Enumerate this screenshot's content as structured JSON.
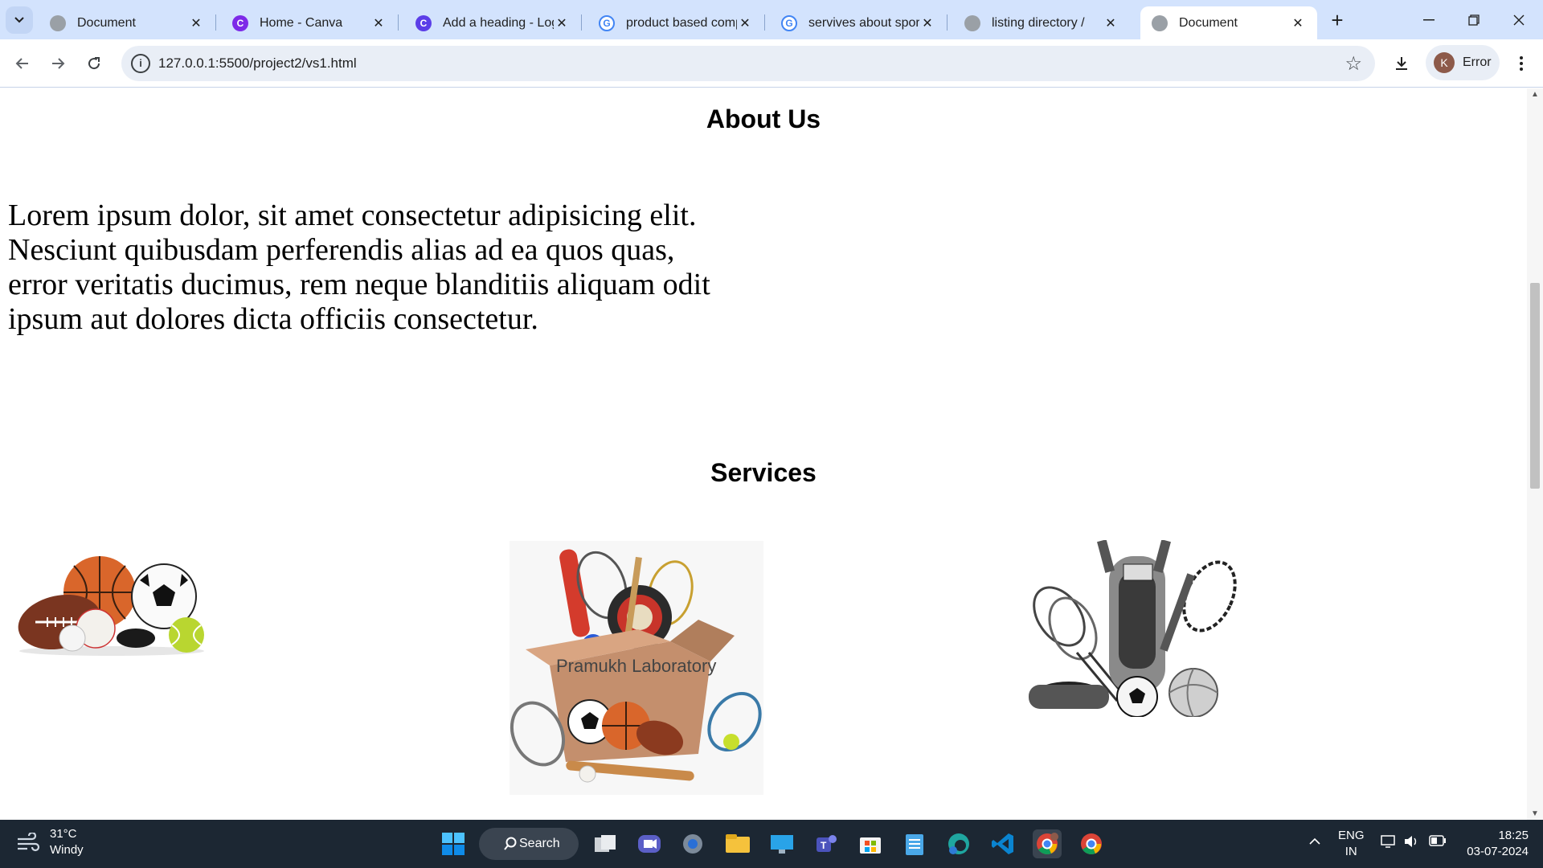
{
  "browser": {
    "tabs": [
      {
        "title": "Document",
        "icon": "globe-icon",
        "active": false
      },
      {
        "title": "Home - Canva",
        "icon": "canva-icon",
        "active": false
      },
      {
        "title": "Add a heading - Logo",
        "icon": "canva-icon",
        "active": false
      },
      {
        "title": "product based comp",
        "icon": "google-icon",
        "active": false
      },
      {
        "title": "servives about sports",
        "icon": "google-icon",
        "active": false
      },
      {
        "title": "listing directory /",
        "icon": "globe-icon",
        "active": false
      },
      {
        "title": "Document",
        "icon": "globe-icon",
        "active": true
      }
    ],
    "url": "127.0.0.1:5500/project2/vs1.html",
    "profile": {
      "initial": "K",
      "label": "Error"
    }
  },
  "page": {
    "about_heading": "About Us",
    "about_text": "Lorem ipsum dolor, sit amet consectetur adipisicing elit. Nesciunt quibusdam perferendis alias ad ea quos quas, error veritatis ducimus, rem neque blanditiis aliquam odit ipsum aut dolores dicta officiis consectetur.",
    "services_heading": "Services",
    "service_images": [
      {
        "name": "sports-balls-image"
      },
      {
        "name": "sports-box-image",
        "caption": "Pramukh Laboratory"
      },
      {
        "name": "sports-equipment-bag-image"
      }
    ]
  },
  "taskbar": {
    "weather": {
      "temp": "31°C",
      "condition": "Windy"
    },
    "search_label": "Search",
    "language": {
      "line1": "ENG",
      "line2": "IN"
    },
    "time": "18:25",
    "date": "03-07-2024"
  },
  "colors": {
    "tabstrip": "#d3e3fd",
    "taskbar": "#1c2733",
    "omnibox": "#e9eef6"
  }
}
